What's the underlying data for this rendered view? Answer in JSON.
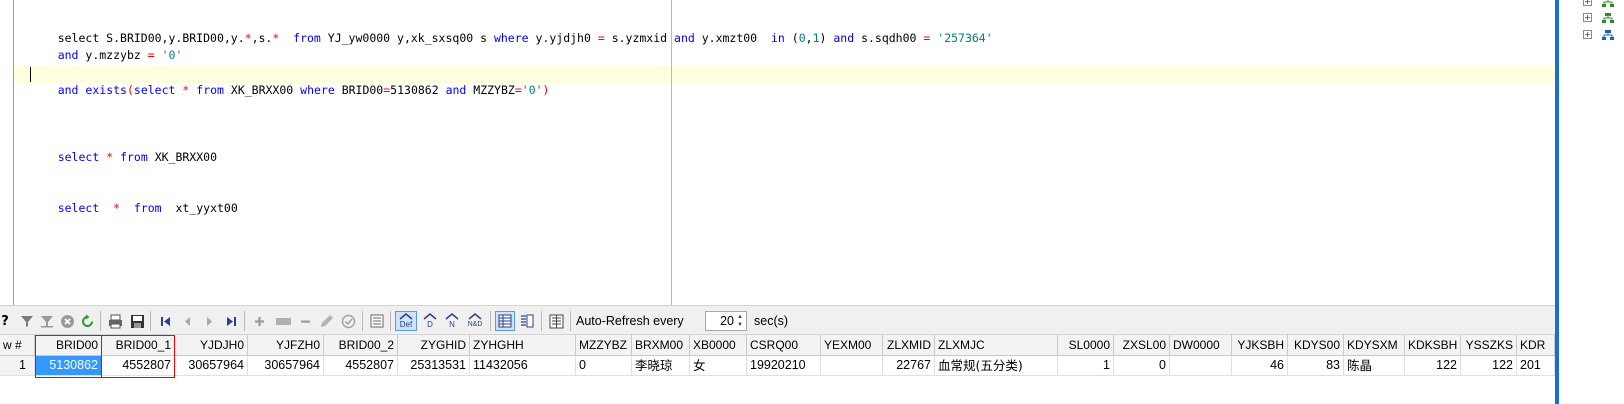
{
  "editor": {
    "lines": [
      [
        "select S.BRID00,y.BRID00,y.",
        "*",
        ",s.",
        "*",
        "  ",
        "from",
        " YJ_yw0000 y,xk_sxsq00 s ",
        "where",
        " y.yjdjh0 ",
        "=",
        " s.yzmxid ",
        "and",
        " y.xmzt00  ",
        "in",
        " (",
        "0",
        ",",
        "1",
        ") ",
        "and",
        " s.sqdh00 ",
        "=",
        " ",
        "'257364'"
      ],
      [
        "and",
        " y.mzzybz ",
        "=",
        " ",
        "'0'"
      ],
      [
        "and",
        " ",
        "exists",
        "(",
        "select",
        " ",
        "*",
        " ",
        "from",
        " XK_BRXX00 ",
        "where",
        " BRID00",
        "=",
        "5130862",
        " ",
        "and",
        " MZZYBZ",
        "=",
        "'0'",
        ")"
      ],
      [
        "select",
        " ",
        "*",
        " ",
        "from",
        " XK_BRXX00"
      ],
      [
        "select",
        "  ",
        "*",
        "  ",
        "from",
        "  xt_yyxt00"
      ]
    ]
  },
  "toolbar": {
    "auto_refresh_label": "Auto-Refresh every",
    "interval_value": "20",
    "interval_unit": "sec(s)",
    "icons": [
      "help-icon",
      "filter-icon",
      "filter-clear-icon",
      "cancel-icon",
      "refresh-icon",
      "print-icon",
      "save-icon",
      "first-record-icon",
      "prior-record-icon",
      "next-record-icon",
      "last-record-icon",
      "add-record-icon",
      "insert-record-icon",
      "delete-record-icon",
      "edit-record-icon",
      "post-record-icon",
      "blob-icon",
      "def-view-icon",
      "d-view-icon",
      "n-view-icon",
      "nd-view-icon",
      "grid-view-icon",
      "form-view-icon",
      "export-icon"
    ],
    "button_texts": {
      "help": "?",
      "def": "Def",
      "d": "D",
      "n": "N",
      "nd": "N&D"
    }
  },
  "grid": {
    "row_header_label": "w #",
    "columns": [
      "BRID00",
      "BRID00_1",
      "YJDJH0",
      "YJFZH0",
      "BRID00_2",
      "ZYGHID",
      "ZYHGHH",
      "MZZYBZ",
      "BRXM00",
      "XB0000",
      "CSRQ00",
      "YEXM00",
      "ZLXMID",
      "ZLXMJC",
      "SL0000",
      "ZXSL00",
      "DW0000",
      "YJKSBH",
      "KDYS00",
      "KDYSXM",
      "KDKSBH",
      "YSSZKS",
      "KDR"
    ],
    "rows": [
      {
        "row_number": "1",
        "cells": [
          "5130862",
          "4552807",
          "30657964",
          "30657964",
          "4552807",
          "25313531",
          "11432056",
          "0",
          "李晓琼",
          "女",
          "19920210",
          "",
          "22767",
          "血常规(五分类)",
          "1",
          "0",
          "",
          "46",
          "83",
          "陈晶",
          "122",
          "122",
          "201"
        ]
      }
    ]
  },
  "colors": {
    "keyword": "#0000ff",
    "string": "#008080",
    "operator": "#ff0000",
    "current_line": "#ffffe0",
    "selection": "#3399ff",
    "highlight_box": "#ff0000"
  }
}
